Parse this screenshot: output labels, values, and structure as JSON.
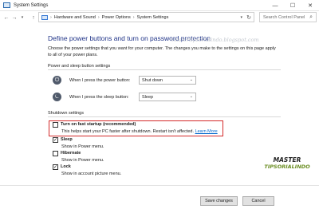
{
  "window": {
    "title": "System Settings"
  },
  "nav": {
    "back": "←",
    "forward": "→",
    "up": "↑"
  },
  "address": {
    "crumbs": [
      "Hardware and Sound",
      "Power Options",
      "System Settings"
    ]
  },
  "search": {
    "placeholder": "Search Control Panel"
  },
  "page": {
    "title": "Define power buttons and turn on password protection",
    "intro": "Choose the power settings that you want for your computer. The changes you make to the settings on this page apply to all of your power plans.",
    "watermark": "mastertipsorialindo.blogspot.com"
  },
  "power_buttons": {
    "heading": "Power and sleep button settings",
    "rows": [
      {
        "label": "When I press the power button:",
        "value": "Shut down"
      },
      {
        "label": "When I press the sleep button:",
        "value": "Sleep"
      }
    ]
  },
  "shutdown": {
    "heading": "Shutdown settings",
    "options": [
      {
        "label": "Turn on fast startup (recommended)",
        "checked": false,
        "desc": "This helps start your PC faster after shutdown. Restart isn't affected.",
        "link": "Learn More"
      },
      {
        "label": "Sleep",
        "checked": true,
        "desc": "Show in Power menu."
      },
      {
        "label": "Hibernate",
        "checked": false,
        "desc": "Show in Power menu."
      },
      {
        "label": "Lock",
        "checked": true,
        "desc": "Show in account picture menu."
      }
    ]
  },
  "logo": {
    "line1": "MASTER",
    "line2": "TIPSORIALINDO"
  },
  "footer": {
    "save": "Save changes",
    "cancel": "Cancel"
  },
  "colors": {
    "title_blue": "#1e3287",
    "link_blue": "#0066cc",
    "highlight_red": "#d42a2a"
  }
}
